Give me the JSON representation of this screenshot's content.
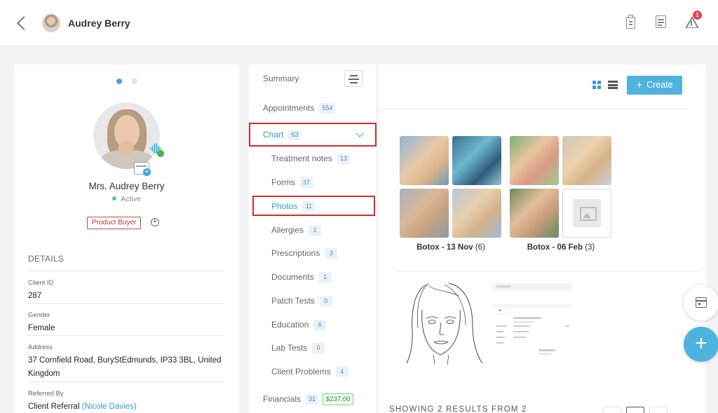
{
  "header": {
    "client_name": "Audrey Berry",
    "notification_count": "1"
  },
  "profile": {
    "full_name": "Mrs. Audrey Berry",
    "status": "Active",
    "tag": "Product Buyer",
    "details_heading": "DETAILS",
    "fields": [
      {
        "label": "Client ID",
        "value": "287"
      },
      {
        "label": "Gender",
        "value": "Female"
      },
      {
        "label": "Address",
        "value": "37 Cornfield Road, BuryStEdmunds, IP33 3BL, United Kingdom"
      },
      {
        "label": "Referred By",
        "value": "Client Referral",
        "link": "(Nicole Davies)"
      }
    ]
  },
  "nav": {
    "summary": "Summary",
    "appointments": {
      "label": "Appointments",
      "count": "554"
    },
    "chart": {
      "label": "Chart",
      "count": "63"
    },
    "sub_items": [
      {
        "label": "Treatment notes",
        "count": "13"
      },
      {
        "label": "Forms",
        "count": "37"
      },
      {
        "label": "Photos",
        "count": "11"
      },
      {
        "label": "Allergies",
        "count": "1"
      },
      {
        "label": "Prescriptions",
        "count": "3"
      },
      {
        "label": "Documents",
        "count": "1"
      },
      {
        "label": "Patch Tests",
        "count": "0"
      },
      {
        "label": "Education",
        "count": "6"
      },
      {
        "label": "Lab Tests",
        "count": "0"
      },
      {
        "label": "Client Problems",
        "count": "4"
      }
    ],
    "financials": {
      "label": "Financials",
      "count": "31",
      "amount": "$237.00"
    }
  },
  "photos": {
    "create_label": "Create",
    "albums": [
      {
        "name": "Botox - 13 Nov",
        "count": "(6)"
      },
      {
        "name": "Botox - 06 Feb",
        "count": "(3)"
      }
    ],
    "results_text": "SHOWING 2 RESULTS FROM 2"
  },
  "colors": {
    "accent": "#4fb3e0",
    "highlight": "#d92b2b",
    "tag_border": "#c6484b",
    "status_active": "#5bc48a"
  }
}
